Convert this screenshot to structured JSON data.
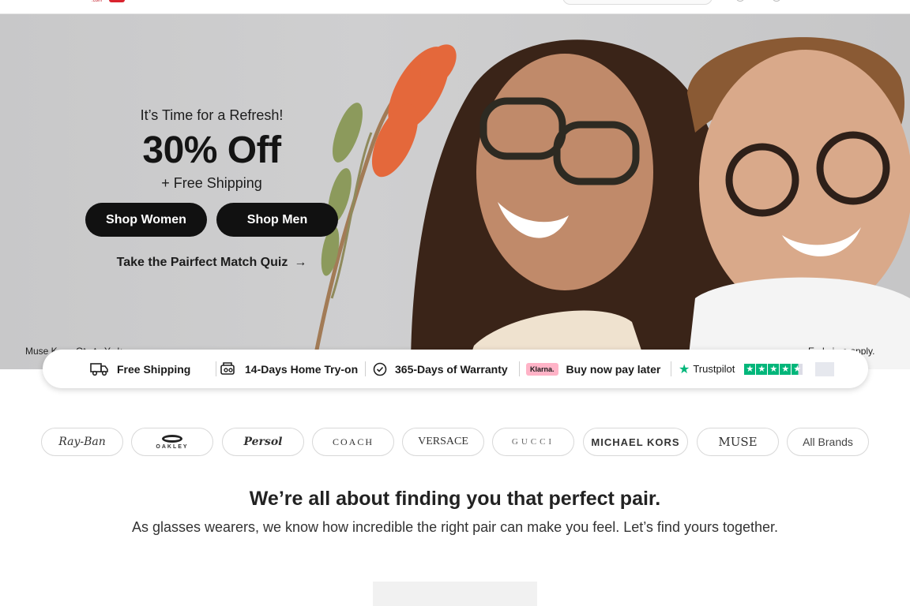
{
  "hero": {
    "kicker": "It’s Time for a Refresh!",
    "title": "30% Off",
    "subtitle": "+ Free Shipping",
    "btn_women": "Shop Women",
    "btn_men": "Shop Men",
    "quiz": "Take the Pairfect Match Quiz",
    "quiz_arrow": "→",
    "fine_left": "Muse K...    ...Ot...t...Y...k",
    "fine_right": "E...l...i...e apply."
  },
  "features": {
    "shipping": "Free Shipping",
    "tryon": "14-Days Home Try-on",
    "warranty": "365-Days of Warranty",
    "klarna_badge": "Klarna.",
    "bnpl": "Buy now pay later",
    "trustpilot": "Trustpilot",
    "trustpilot_stars": 4.5,
    "colors": {
      "trustpilot_green": "#00b67a",
      "klarna_pink": "#ffb3c7"
    }
  },
  "brands": {
    "rayban": "Ray-Ban",
    "oakley": "OAKLEY",
    "persol": "Persol",
    "coach": "COACH",
    "versace": "VERSACE",
    "gucci": "GUCCI",
    "michaelkors": "MICHAEL KORS",
    "muse": "MUSE",
    "all": "All Brands"
  },
  "intro": {
    "title": "We’re all about finding you that perfect pair.",
    "text": "As glasses wearers, we know how incredible the right pair can make you feel. Let’s find yours together."
  }
}
